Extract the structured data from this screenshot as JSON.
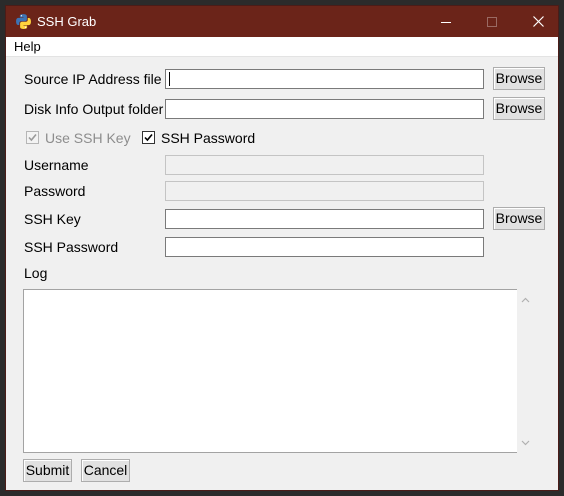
{
  "window": {
    "title": "SSH Grab",
    "app_icon": "python-icon",
    "controls": {
      "minimize": "minimize-icon",
      "maximize": "maximize-icon",
      "close": "close-icon"
    }
  },
  "menubar": {
    "items": [
      {
        "label": "Help"
      }
    ]
  },
  "form": {
    "source_ip": {
      "label": "Source IP Address file",
      "value": "",
      "browse_label": "Browse"
    },
    "disk_info": {
      "label": "Disk Info Output folder",
      "value": "",
      "browse_label": "Browse"
    },
    "use_ssh_key": {
      "label": "Use SSH Key",
      "checked": true,
      "enabled": false
    },
    "ssh_password_toggle": {
      "label": "SSH Password",
      "checked": true,
      "enabled": true
    },
    "username": {
      "label": "Username",
      "value": "",
      "enabled": false
    },
    "password": {
      "label": "Password",
      "value": "",
      "enabled": false
    },
    "ssh_key": {
      "label": "SSH Key",
      "value": "",
      "browse_label": "Browse"
    },
    "ssh_password": {
      "label": "SSH Password",
      "value": ""
    }
  },
  "log": {
    "label": "Log",
    "content": ""
  },
  "actions": {
    "submit_label": "Submit",
    "cancel_label": "Cancel"
  },
  "colors": {
    "titlebar": "#6b2419",
    "window_bg": "#f0f0f0",
    "button_bg": "#e1e1e1"
  }
}
